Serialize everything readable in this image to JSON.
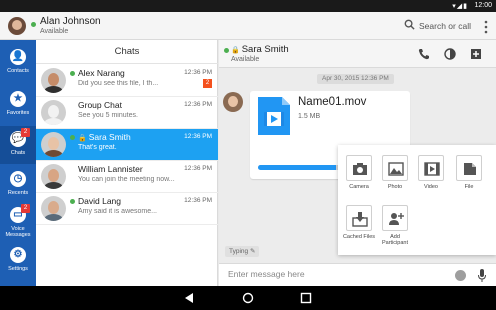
{
  "statusbar": {
    "time": "12:00",
    "signal": "▾◢▮"
  },
  "header": {
    "user_name": "Alan Johnson",
    "user_status": "Available",
    "search_label": "Search or call"
  },
  "nav": [
    {
      "label": "Contacts",
      "icon": "contacts-icon",
      "glyph": "👤",
      "badge": ""
    },
    {
      "label": "Favorites",
      "icon": "star-icon",
      "glyph": "★",
      "badge": ""
    },
    {
      "label": "Chats",
      "icon": "chat-icon",
      "glyph": "💬",
      "badge": "2"
    },
    {
      "label": "Recents",
      "icon": "clock-icon",
      "glyph": "◷",
      "badge": ""
    },
    {
      "label": "Voice Messages",
      "icon": "voicemail-icon",
      "glyph": "▭",
      "badge": "2"
    },
    {
      "label": "Settings",
      "icon": "gear-icon",
      "glyph": "⚙",
      "badge": ""
    }
  ],
  "chats": {
    "title": "Chats",
    "items": [
      {
        "name": "Alex Narang",
        "preview": "Did you see this file, I th...",
        "time": "12:36 PM",
        "badge": "2",
        "online": true,
        "locked": false,
        "selected": false
      },
      {
        "name": "Group Chat",
        "preview": "See you 5 minutes.",
        "time": "12:36 PM",
        "badge": "",
        "online": false,
        "locked": false,
        "selected": false
      },
      {
        "name": "Sara Smith",
        "preview": "That's great.",
        "time": "12:36 PM",
        "badge": "",
        "online": true,
        "locked": true,
        "selected": true
      },
      {
        "name": "William Lannister",
        "preview": "You can join the meeting now...",
        "time": "12:36 PM",
        "badge": "",
        "online": false,
        "locked": false,
        "selected": false
      },
      {
        "name": "David Lang",
        "preview": "Amy said it is awesome...",
        "time": "12:36 PM",
        "badge": "",
        "online": true,
        "locked": false,
        "selected": false
      }
    ]
  },
  "conversation": {
    "contact_name": "Sara Smith",
    "contact_status": "Available",
    "date": "Apr 30, 2015 12:36 PM",
    "file_name": "Name01.mov",
    "file_size": "1.5 MB",
    "upload_progress": 0.6,
    "typing_label": "Typing",
    "composer_placeholder": "Enter message here"
  },
  "attach_menu": [
    {
      "label": "Camera",
      "icon": "camera-icon"
    },
    {
      "label": "Photo",
      "icon": "photo-icon"
    },
    {
      "label": "Video",
      "icon": "video-icon"
    },
    {
      "label": "File",
      "icon": "file-icon"
    },
    {
      "label": "Cached Files",
      "icon": "cached-files-icon"
    },
    {
      "label": "Add Participant",
      "icon": "add-participant-icon"
    }
  ],
  "colors": {
    "nav_blue": "#1e5fb4",
    "selected": "#1da1f2",
    "online": "#4caf50",
    "badge": "#e53935"
  }
}
